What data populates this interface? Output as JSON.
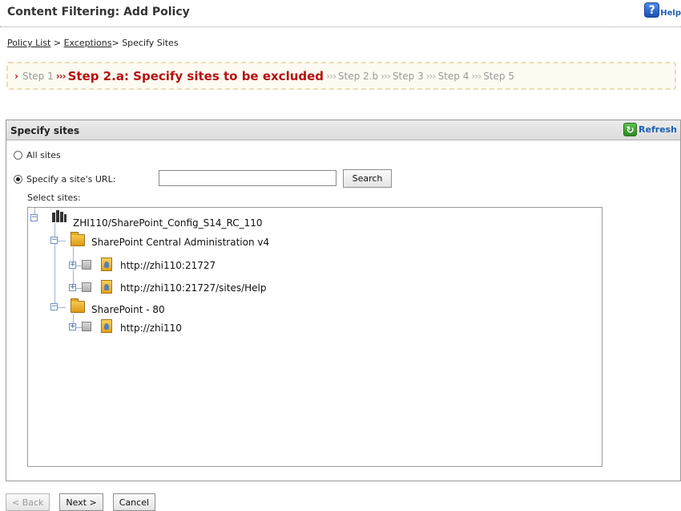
{
  "header": {
    "title": "Content Filtering: Add Policy",
    "help_label": "Help"
  },
  "breadcrumb": {
    "items": [
      "Policy List",
      "Exceptions"
    ],
    "current": "Specify Sites"
  },
  "wizard": {
    "step1": "Step 1",
    "step2a": "Step 2.a: Specify sites to be excluded",
    "step2b": "Step 2.b",
    "step3": "Step 3",
    "step4": "Step 4",
    "step5": "Step 5",
    "separator": "›››"
  },
  "panel": {
    "title": "Specify sites",
    "refresh_label": "Refresh",
    "all_sites_label": "All sites",
    "specify_url_label": "Specify a site's URL:",
    "url_value": "",
    "search_label": "Search",
    "select_sites_label": "Select sites:"
  },
  "tree": {
    "farm": "ZHI110/SharePoint_Config_S14_RC_110",
    "web_apps": [
      {
        "name": "SharePoint Central Administration v4",
        "sites": [
          "http://zhi110:21727",
          "http://zhi110:21727/sites/Help"
        ]
      },
      {
        "name": "SharePoint - 80",
        "sites": [
          "http://zhi110"
        ]
      }
    ]
  },
  "footer": {
    "back_label": "< Back",
    "next_label": "Next >",
    "cancel_label": "Cancel"
  },
  "colors": {
    "active_step": "#b51212",
    "link": "#1a5fb4",
    "tree_line": "#9bb3d9"
  }
}
